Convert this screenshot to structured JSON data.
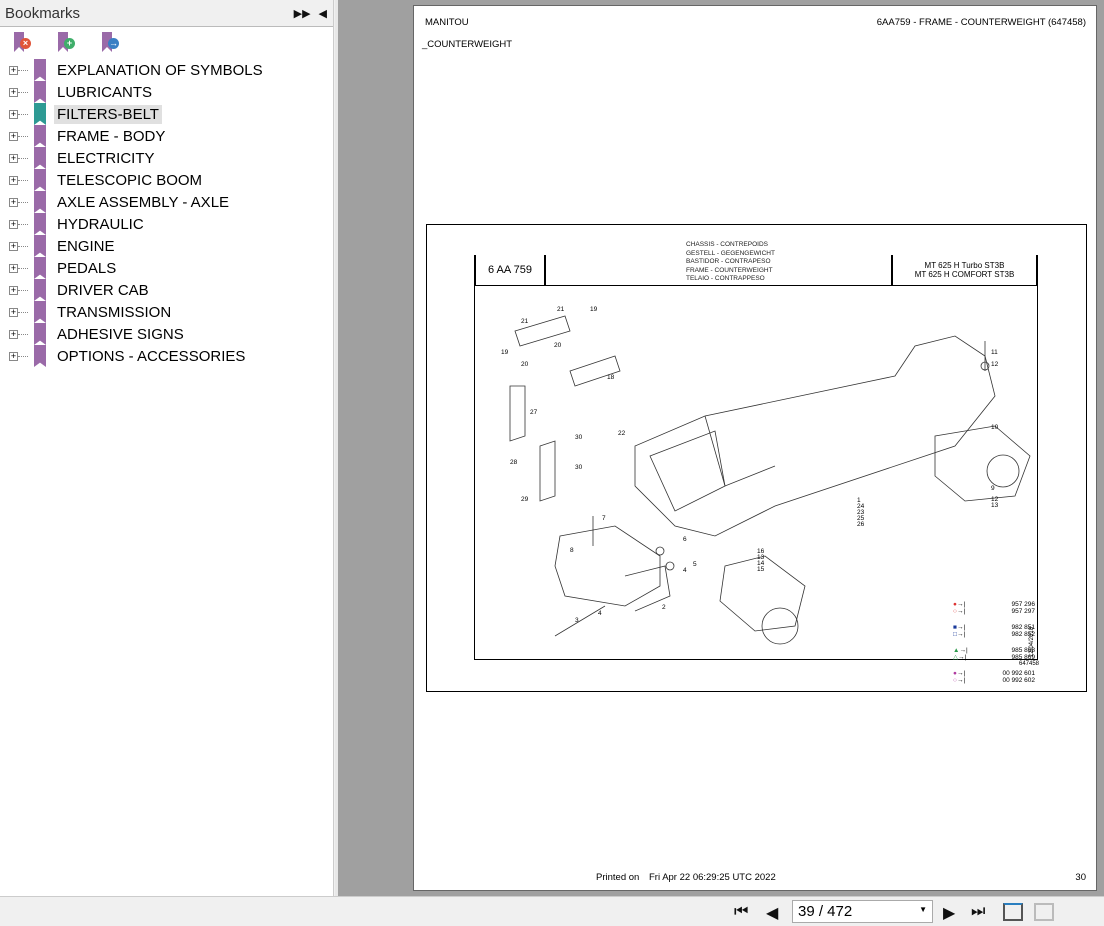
{
  "sidebar": {
    "title": "Bookmarks",
    "items": [
      {
        "label": "EXPLANATION OF SYMBOLS"
      },
      {
        "label": "LUBRICANTS"
      },
      {
        "label": "FILTERS-BELT",
        "selected": true
      },
      {
        "label": "FRAME - BODY"
      },
      {
        "label": "ELECTRICITY"
      },
      {
        "label": "TELESCOPIC BOOM"
      },
      {
        "label": "AXLE ASSEMBLY - AXLE"
      },
      {
        "label": "HYDRAULIC"
      },
      {
        "label": "ENGINE"
      },
      {
        "label": "PEDALS"
      },
      {
        "label": "DRIVER CAB"
      },
      {
        "label": "TRANSMISSION"
      },
      {
        "label": "ADHESIVE SIGNS"
      },
      {
        "label": "OPTIONS - ACCESSORIES"
      }
    ]
  },
  "page": {
    "brand": "MANITOU",
    "header_right": "6AA759 - FRAME - COUNTERWEIGHT (647458)",
    "subtitle": "_COUNTERWEIGHT",
    "printed_label": "Printed on",
    "printed_date": "Fri Apr 22 06:29:25 UTC 2022",
    "page_number": "30"
  },
  "drawing": {
    "code": "6 AA 759",
    "titles": [
      "CHASSIS - CONTREPOIDS",
      "GESTELL - GEGENGEWICHT",
      "BASTIDOR - CONTRAPESO",
      "FRAME - COUNTERWEIGHT",
      "TELAIO - CONTRAPPESO"
    ],
    "models": [
      "MT 625 H Turbo ST3B",
      "MT 625 H COMFORT ST3B"
    ],
    "legend": [
      "957 296",
      "957 297",
      "982 851",
      "982 852",
      "985 868",
      "985 869",
      "00 992 601",
      "00 992 602"
    ],
    "date": "12/04/2018",
    "ref": "647458",
    "callouts": [
      "21",
      "19",
      "21",
      "20",
      "19",
      "20",
      "18",
      "27",
      "22",
      "30",
      "28",
      "30",
      "29",
      "7",
      "8",
      "6",
      "5",
      "4",
      "3",
      "4",
      "2",
      "16",
      "13",
      "14",
      "15",
      "11",
      "12",
      "10",
      "9",
      "12",
      "13",
      "1",
      "24",
      "23",
      "25",
      "26"
    ]
  },
  "toolbar": {
    "page_input": "39 / 472"
  },
  "colors": {
    "bookmark": "#9a6aa8",
    "selected_bookmark": "#2e9a94",
    "viewer_bg": "#a0a0a0"
  }
}
